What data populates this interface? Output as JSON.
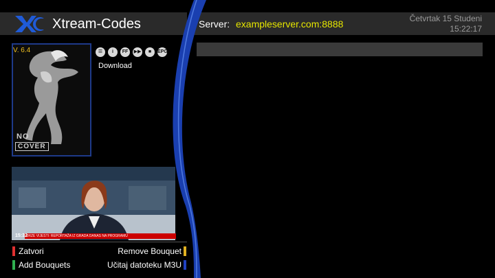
{
  "header": {
    "brand": "Xtream-Codes",
    "server_label": "Server:",
    "server_value": "exampleserver.com:8888",
    "date": "Četvrtak 15 Studeni",
    "time": "15:22:17"
  },
  "cover": {
    "version": "V. 6.4",
    "no_label": "NO",
    "cover_label": "COVER"
  },
  "toolbar": {
    "icons": [
      "menu-icon",
      "info-icon",
      "ffw-icon",
      "rec-icon",
      "stop-icon",
      "epg-icon"
    ],
    "icon_glyphs": [
      "☰",
      "i",
      "FF",
      "▶▶",
      "■",
      "EPG"
    ],
    "download_label": "Download"
  },
  "preview": {
    "ticker_time": "15:32",
    "ticker_text": "BRZE VIJESTI: REPORTAŽA IZ GRADA DANAS NA PROGRAMU"
  },
  "legend": {
    "red": "Zatvori",
    "green": "Add Bouquets",
    "yellow": "Remove Bouquet",
    "blue": "Učitaj datoteku M3U"
  },
  "colors": {
    "red": "#e03030",
    "green": "#30b050",
    "yellow": "#e0b020",
    "blue": "#2040c0",
    "accent_blue": "#1e3a8a",
    "server_value": "#e6e600"
  }
}
